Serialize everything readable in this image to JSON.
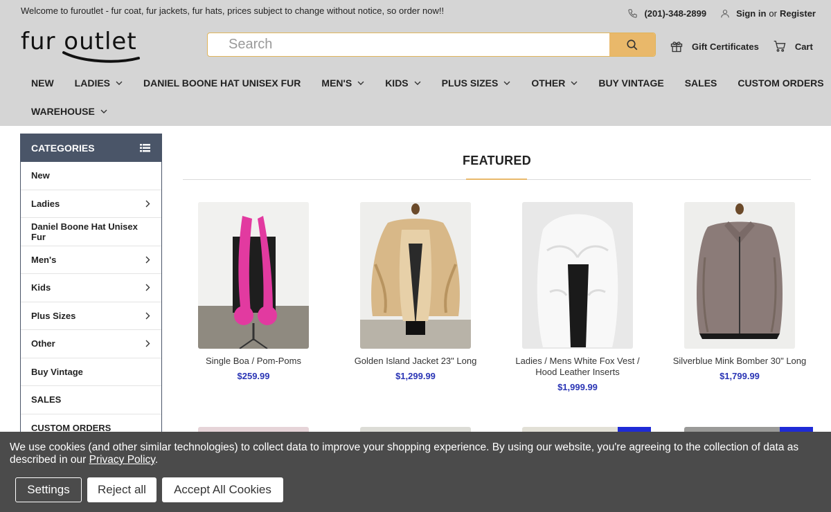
{
  "top_bar": {
    "welcome": "Welcome to furoutlet - fur coat, fur jackets, fur hats, prices subject to change without notice, so order now!!",
    "phone": "(201)-348-2899",
    "sign_in": "Sign in",
    "or": "or",
    "register": "Register"
  },
  "logo": {
    "text": "fur outlet"
  },
  "search": {
    "placeholder": "Search"
  },
  "header_actions": {
    "gift": "Gift Certificates",
    "cart": "Cart"
  },
  "nav": {
    "row1": [
      {
        "label": "NEW",
        "dropdown": false
      },
      {
        "label": "LADIES",
        "dropdown": true
      },
      {
        "label": "DANIEL BOONE HAT UNISEX FUR",
        "dropdown": false
      },
      {
        "label": "MEN'S",
        "dropdown": true
      },
      {
        "label": "KIDS",
        "dropdown": true
      },
      {
        "label": "PLUS SIZES",
        "dropdown": true
      },
      {
        "label": "OTHER",
        "dropdown": true
      },
      {
        "label": "BUY VINTAGE",
        "dropdown": false
      },
      {
        "label": "SALES",
        "dropdown": false
      },
      {
        "label": "CUSTOM ORDERS",
        "dropdown": false
      }
    ],
    "row2": [
      {
        "label": "WAREHOUSE",
        "dropdown": true
      }
    ]
  },
  "sidebar": {
    "title": "CATEGORIES",
    "items": [
      {
        "label": "New",
        "arrow": false
      },
      {
        "label": "Ladies",
        "arrow": true
      },
      {
        "label": "Daniel Boone Hat Unisex Fur",
        "arrow": false
      },
      {
        "label": "Men's",
        "arrow": true
      },
      {
        "label": "Kids",
        "arrow": true
      },
      {
        "label": "Plus Sizes",
        "arrow": true
      },
      {
        "label": "Other",
        "arrow": true
      },
      {
        "label": "Buy Vintage",
        "arrow": false
      },
      {
        "label": "SALES",
        "arrow": false
      },
      {
        "label": "CUSTOM ORDERS",
        "arrow": false
      }
    ]
  },
  "featured": {
    "title": "FEATURED",
    "products": [
      {
        "name": "Single Boa / Pom-Poms",
        "price": "$259.99"
      },
      {
        "name": "Golden Island Jacket 23\" Long",
        "price": "$1,299.99"
      },
      {
        "name": "Ladies / Mens White Fox Vest / Hood Leather Inserts",
        "price": "$1,999.99"
      },
      {
        "name": "Silverblue Mink Bomber 30\" Long",
        "price": "$1,799.99"
      }
    ]
  },
  "cookie": {
    "message_before_link": "We use cookies (and other similar technologies) to collect data to improve your shopping experience. By using our website, you're agreeing to the collection of data as described in our ",
    "link": "Privacy Policy",
    "message_after_link": ".",
    "settings": "Settings",
    "reject": "Reject all",
    "accept": "Accept All Cookies"
  },
  "colors": {
    "header_bg": "#d5d5d5",
    "accent": "#e9b86a",
    "sidebar_head": "#4a5568",
    "price": "#2a35b5",
    "cookie_bg": "#4b4b4b"
  }
}
